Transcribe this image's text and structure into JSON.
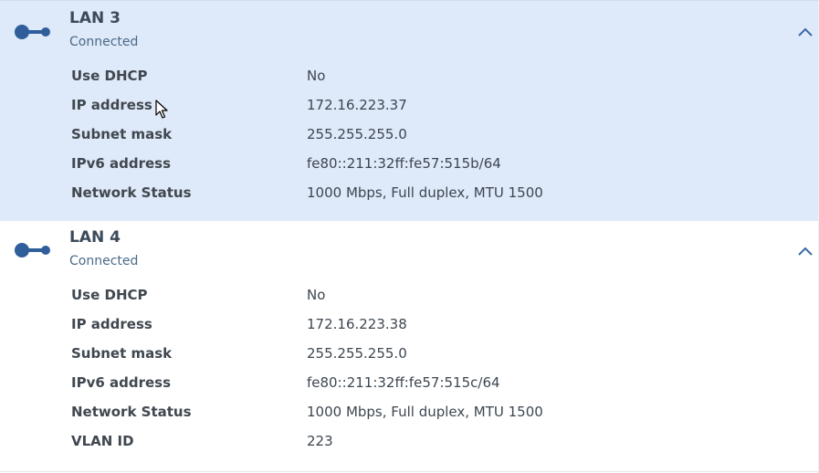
{
  "colors": {
    "icon": "#2f5e9a",
    "selected_bg": "#dee9f9"
  },
  "interfaces": [
    {
      "name": "LAN 3",
      "status": "Connected",
      "icon": "ethernet-connection-icon",
      "expand_icon": "chevron-up-icon",
      "rows": [
        {
          "label": "Use DHCP",
          "value": "No"
        },
        {
          "label": "IP address",
          "value": "172.16.223.37"
        },
        {
          "label": "Subnet mask",
          "value": "255.255.255.0"
        },
        {
          "label": "IPv6 address",
          "value": "fe80::211:32ff:fe57:515b/64"
        },
        {
          "label": "Network Status",
          "value": "1000 Mbps, Full duplex, MTU 1500"
        }
      ]
    },
    {
      "name": "LAN 4",
      "status": "Connected",
      "icon": "ethernet-connection-icon",
      "expand_icon": "chevron-up-icon",
      "rows": [
        {
          "label": "Use DHCP",
          "value": "No"
        },
        {
          "label": "IP address",
          "value": "172.16.223.38"
        },
        {
          "label": "Subnet mask",
          "value": "255.255.255.0"
        },
        {
          "label": "IPv6 address",
          "value": "fe80::211:32ff:fe57:515c/64"
        },
        {
          "label": "Network Status",
          "value": "1000 Mbps, Full duplex, MTU 1500"
        },
        {
          "label": "VLAN ID",
          "value": "223"
        }
      ]
    }
  ]
}
